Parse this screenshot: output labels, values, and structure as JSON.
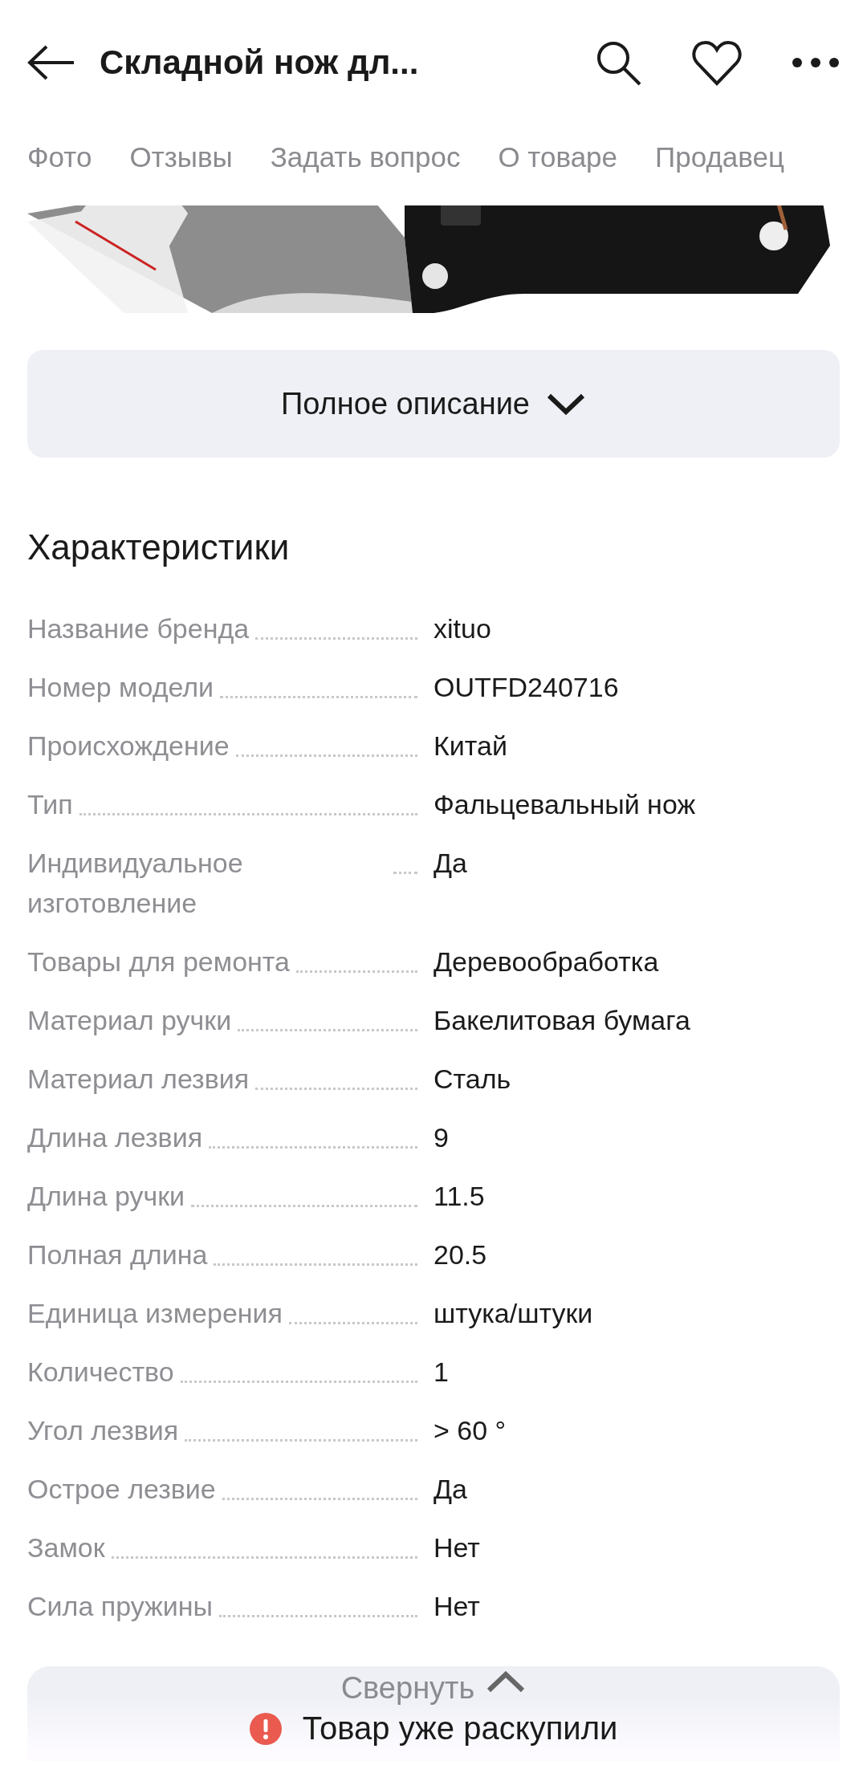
{
  "header": {
    "title": "Складной нож дл..."
  },
  "tabs": [
    {
      "label": "Фото",
      "selected": false
    },
    {
      "label": "Отзывы",
      "selected": false
    },
    {
      "label": "Задать вопрос",
      "selected": false
    },
    {
      "label": "О товаре",
      "selected": false
    },
    {
      "label": "Продавец",
      "selected": false
    }
  ],
  "description_button": {
    "label": "Полное описание"
  },
  "specs": {
    "title": "Характеристики",
    "rows": [
      {
        "label": "Название бренда",
        "value": "xituo"
      },
      {
        "label": "Номер модели",
        "value": "OUTFD240716"
      },
      {
        "label": "Происхождение",
        "value": "Китай"
      },
      {
        "label": "Тип",
        "value": "Фальцевальный нож"
      },
      {
        "label": "Индивидуальное изготовление",
        "value": "Да"
      },
      {
        "label": "Товары для ремонта",
        "value": "Деревообработка"
      },
      {
        "label": "Материал ручки",
        "value": "Бакелитовая бумага"
      },
      {
        "label": "Материал лезвия",
        "value": "Сталь"
      },
      {
        "label": "Длина лезвия",
        "value": "9"
      },
      {
        "label": "Длина ручки",
        "value": "11.5"
      },
      {
        "label": "Полная длина",
        "value": "20.5"
      },
      {
        "label": "Единица измерения",
        "value": "штука/штуки"
      },
      {
        "label": "Количество",
        "value": "1"
      },
      {
        "label": "Угол лезвия",
        "value": "> 60 °"
      },
      {
        "label": "Острое лезвие",
        "value": "Да"
      },
      {
        "label": "Замок",
        "value": "Нет"
      },
      {
        "label": "Сила пружины",
        "value": "Нет"
      }
    ]
  },
  "collapse_button": {
    "label": "Свернуть"
  },
  "toast": {
    "text": "Товар уже раскупили"
  }
}
